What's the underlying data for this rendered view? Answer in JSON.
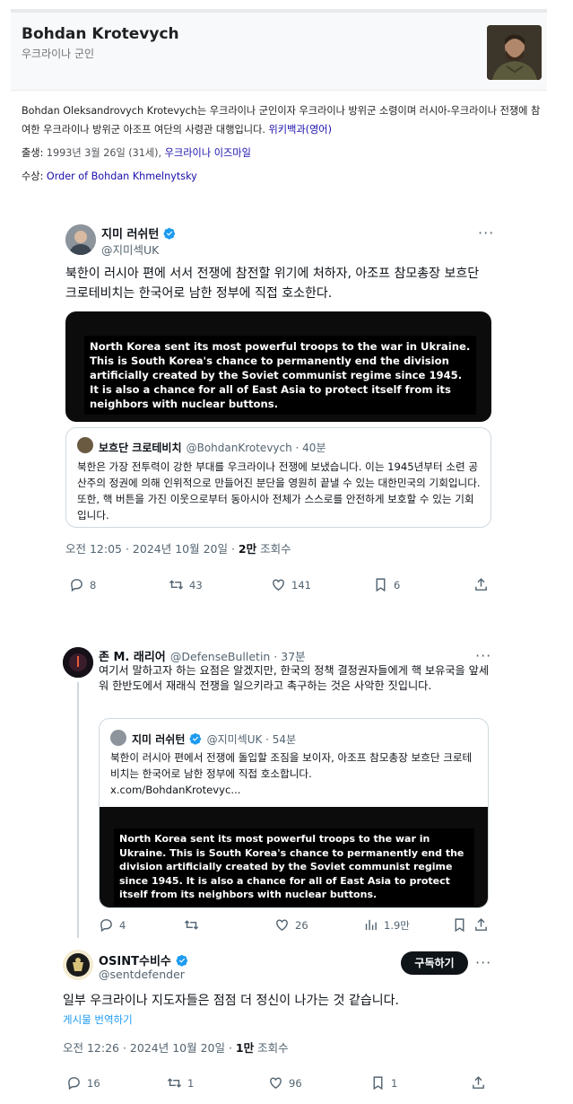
{
  "knowledge_panel": {
    "name": "Bohdan Krotevych",
    "subtitle": "우크라이나 군인",
    "description": "Bohdan Oleksandrovych Krotevych는 우크라이나 군인이자 우크라이나 방위군 소령이며 러시아-우크라이나 전쟁에 참여한 우크라이나 방위군 아조프 여단의 사령관 대행입니다.",
    "wiki_link": "위키백과(영어)",
    "born_label": "출생:",
    "born_value": "1993년 3월 26일 (31세),",
    "born_place": "우크라이나 이즈마일",
    "award_label": "수상:",
    "award_value": "Order of Bohdan Khmelnytsky"
  },
  "tweet1": {
    "name": "지미 러쉬턴",
    "handle": "@지미섹UK",
    "text": "북한이 러시아 편에 서서 전쟁에 참전할 위기에 처하자, 아조프 참모총장 보흐단 크로테비치는 한국어로 남한 정부에 직접 호소한다.",
    "media_text": "North Korea sent its most powerful troops to the war in Ukraine. This is South Korea's chance to permanently end the division artificially created by the Soviet communist regime since 1945. It is also a chance for all of East Asia to protect itself from its neighbors with nuclear buttons.",
    "quote": {
      "name": "보흐단 크로테비치",
      "handle": "@BohdanKrotevych · 40분",
      "text": "북한은 가장 전투력이 강한 부대를 우크라이나 전쟁에 보냈습니다. 이는 1945년부터 소련 공산주의 정권에 의해 인위적으로 만들어진 분단을 영원히 끝낼 수 있는 대한민국의 기회입니다. 또한, 핵 버튼을 가진 이웃으로부터 동아시아 전체가 스스로를 안전하게 보호할 수 있는 기회입니다."
    },
    "time": "오전 12:05 · 2024년 10월 20일 ·",
    "views_count": "2만",
    "views_label": "조회수",
    "replies": "8",
    "retweets": "43",
    "likes": "141",
    "bookmarks": "6"
  },
  "tweet2": {
    "name": "존 M. 래리어",
    "handle": "@DefenseBulletin · 37분",
    "text": "여기서 말하고자 하는 요점은 알겠지만, 한국의 정책 결정권자들에게 핵 보유국을 앞세워 한반도에서 재래식 전쟁을 일으키라고 촉구하는 것은 사악한 짓입니다.",
    "quote": {
      "name": "지미 러쉬턴",
      "handle": "@지미섹UK · 54분",
      "text": "북한이 러시아 편에서 전쟁에 돌입할 조짐을 보이자, 아조프 참모총장 보흐단 크로테비치는 한국어로 남한 정부에 직접 호소합니다.",
      "link": "x.com/BohdanKrotevyc...",
      "media_text": "North Korea sent its most powerful troops to the war in Ukraine. This is South Korea's chance to permanently end the division artificially created by the Soviet communist regime since 1945. It is also a chance for all of East Asia to protect itself from its neighbors with nuclear buttons."
    },
    "replies": "4",
    "likes": "26",
    "views": "1.9만"
  },
  "tweet3": {
    "name": "OSINT수비수",
    "handle": "@sentdefender",
    "subscribe": "구독하기",
    "text": "일부 우크라이나 지도자들은 점점 더 정신이 나가는 것 같습니다.",
    "translate": "게시물 번역하기",
    "time": "오전 12:26 · 2024년 10월 20일 ·",
    "views_count": "1만",
    "views_label": "조회수",
    "replies": "16",
    "retweets": "1",
    "likes": "96",
    "bookmarks": "1"
  },
  "icons": [
    "verified-icon",
    "more-icon",
    "reply-icon",
    "retweet-icon",
    "like-icon",
    "bookmark-icon",
    "share-icon",
    "views-icon"
  ],
  "colors": {
    "verified": "#1d9bf0",
    "link": "#1a0dab",
    "muted": "#536471"
  }
}
